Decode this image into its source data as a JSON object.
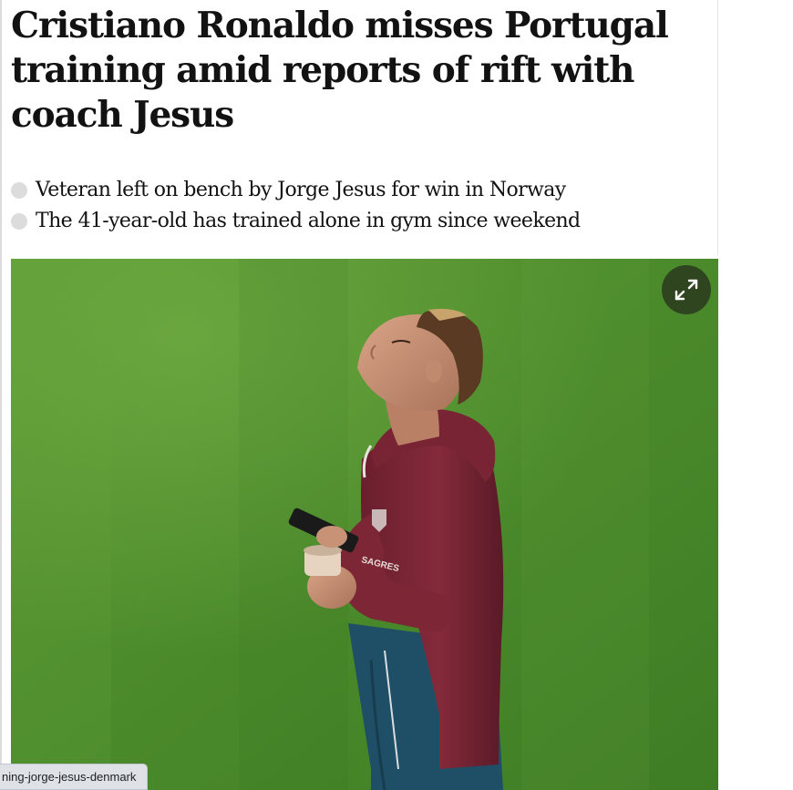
{
  "article": {
    "headline": "Cristiano Ronaldo misses Portugal training amid reports of rift with coach Jesus",
    "standfirst": [
      "Veteran left on bench by Jorge Jesus for win in Norway",
      "The 41-year-old has trained alone in gym since weekend"
    ]
  },
  "photo": {
    "expand_icon": "expand-arrows-icon",
    "shirt_text": "SAGRES"
  },
  "status_bar": {
    "url_text": "ning-jorge-jesus-denmark"
  },
  "colors": {
    "text": "#121212",
    "bullet": "#dcdcdc",
    "grass": "#4a8a2a",
    "hoodie": "#7a2535",
    "jacket_lower": "#1f4f66",
    "status_bg": "#dee1e6"
  }
}
